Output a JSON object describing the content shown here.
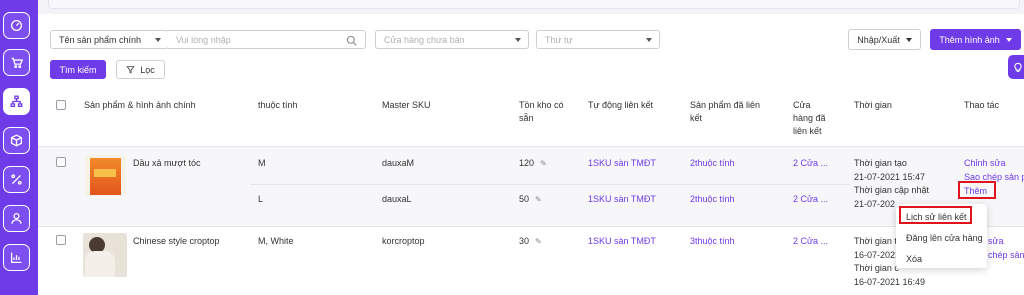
{
  "colors": {
    "accent": "#6f3ae8",
    "highlight": "#e0141e"
  },
  "sidebar": {
    "icons": [
      "dashboard-icon",
      "cart-icon",
      "sitemap-icon",
      "box-icon",
      "percent-icon",
      "users-icon",
      "chart-icon"
    ]
  },
  "filters": {
    "field_select": "Tên sản phẩm chính",
    "search_placeholder": "Vui lòng nhập",
    "store_select_placeholder": "Cửa hàng chưa bán",
    "order_select_placeholder": "Thứ tự",
    "import_export_label": "Nhập/Xuất",
    "add_image_label": "Thêm hình ảnh",
    "search_button": "Tìm kiếm",
    "filter_button": "Lọc"
  },
  "table": {
    "headers": {
      "product": "Sản phẩm & hình ảnh chính",
      "attribute": "thuộc tính",
      "master_sku": "Master SKU",
      "stock_line1": "Tồn kho có",
      "stock_line2": "sẵn",
      "auto_link": "Tự động liên kết",
      "linked_line1": "Sản phẩm đã liên",
      "linked_line2": "kết",
      "stores_line1": "Cửa",
      "stores_line2": "hàng đã",
      "stores_line3": "liên kết",
      "time": "Thời gian",
      "actions": "Thao tác"
    },
    "rows": [
      {
        "name": "Dầu xả mượt tóc",
        "variants": [
          {
            "attribute": "M",
            "sku": "dauxaM",
            "stock": "120",
            "auto_link": "1SKU sàn TMĐT",
            "linked": "2thuộc tính",
            "stores": "2 Cửa ..."
          },
          {
            "attribute": "L",
            "sku": "dauxaL",
            "stock": "50",
            "auto_link": "1SKU sàn TMĐT",
            "linked": "2thuộc tính",
            "stores": "2 Cửa ..."
          }
        ],
        "created_label": "Thời gian tạo",
        "created_value": "21-07-2021 15:47",
        "updated_label": "Thời gian cập nhật",
        "updated_value": "21-07-202",
        "action_edit": "Chỉnh sửa",
        "action_copy": "Sao chép sản p",
        "action_more": "Thêm"
      },
      {
        "name": "Chinese style croptop",
        "attribute": "M, White",
        "sku": "korcroptop",
        "stock": "30",
        "auto_link": "1SKU sàn TMĐT",
        "linked": "3thuộc tính",
        "stores": "2 Cửa ...",
        "created_label": "Thời gian t",
        "created_value": "16-07-2021",
        "updated_label": "Thời gian c",
        "updated_value": "16-07-2021 16:49",
        "action_edit": "sửa",
        "action_copy": "chép sản p"
      }
    ]
  },
  "more_menu": {
    "items": [
      "Lịch sử liên kết",
      "Đăng lên cửa hàng",
      "Xóa"
    ]
  }
}
